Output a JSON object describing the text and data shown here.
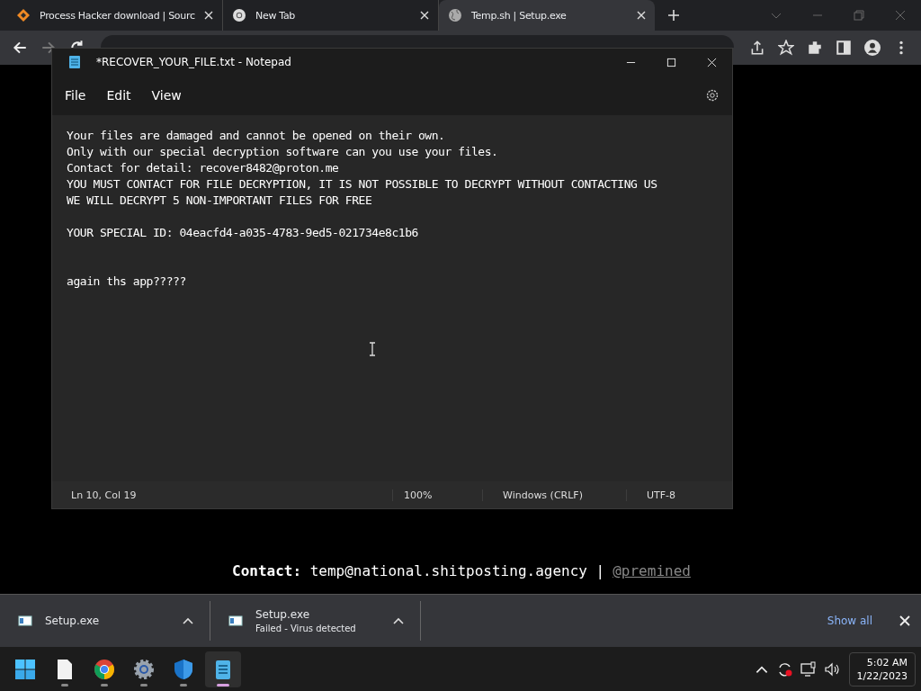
{
  "browser": {
    "tabs": [
      {
        "title": "Process Hacker download | Sourc",
        "selected": false,
        "kind": "diamond"
      },
      {
        "title": "New Tab",
        "selected": false,
        "kind": "chrome"
      },
      {
        "title": "Temp.sh | Setup.exe",
        "selected": true,
        "kind": "globe"
      }
    ]
  },
  "notepad": {
    "title": "*RECOVER_YOUR_FILE.txt - Notepad",
    "menu": [
      "File",
      "Edit",
      "View"
    ],
    "text": "Your files are damaged and cannot be opened on their own.\nOnly with our special decryption software can you use your files.\nContact for detail: recover8482@proton.me\nYOU MUST CONTACT FOR FILE DECRYPTION, IT IS NOT POSSIBLE TO DECRYPT WITHOUT CONTACTING US\nWE WILL DECRYPT 5 NON-IMPORTANT FILES FOR FREE\n\nYOUR SPECIAL ID: 04eacfd4-a035-4783-9ed5-021734e8c1b6\n\n\nagain ths app?????",
    "status_bar": [
      "Ln 10, Col 19",
      "100%",
      "Windows (CRLF)",
      "UTF-8"
    ]
  },
  "page": {
    "contact": "**Contact:** temp@national.shitposting.agency |",
    "link": "@premined"
  },
  "downloads": {
    "items": [
      {
        "name": "Setup.exe"
      },
      {
        "name": "Setup.exe",
        "status": "Failed - Virus detected"
      }
    ],
    "show_all": "Show all"
  },
  "taskbar": {
    "apps": [
      {
        "kind": "start",
        "selected": false
      },
      {
        "kind": "file",
        "selected": false
      },
      {
        "kind": "chrome",
        "selected": false
      },
      {
        "kind": "settings",
        "selected": false
      },
      {
        "kind": "shield",
        "selected": false
      },
      {
        "kind": "notepad",
        "selected": true
      }
    ],
    "time": "5:02 AM",
    "date": "1/22/2023"
  }
}
